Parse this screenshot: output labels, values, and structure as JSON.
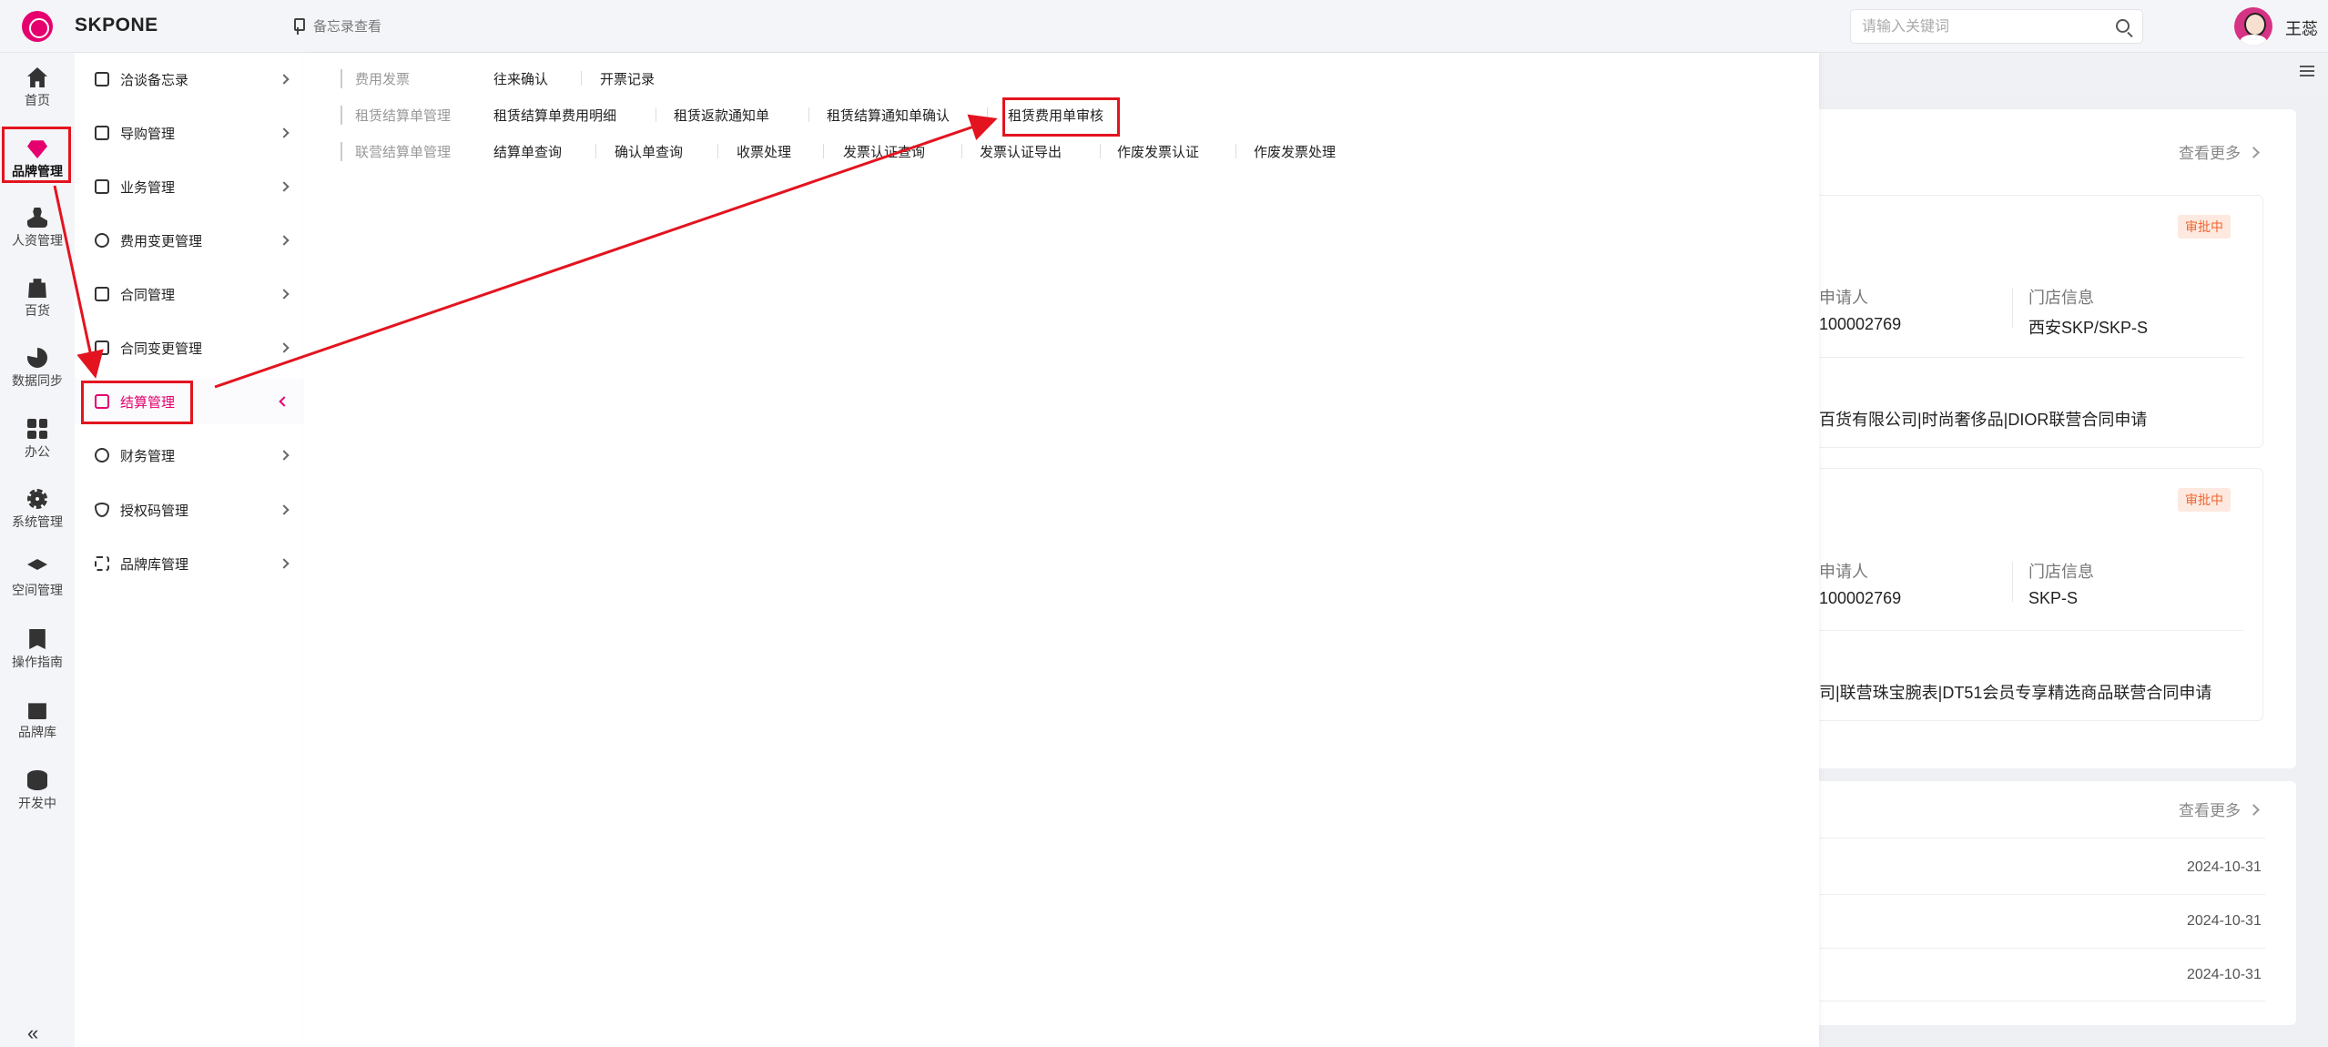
{
  "header": {
    "brand": "SKPONE",
    "memo_label": "备忘录查看",
    "search_placeholder": "请输入关键词",
    "username": "王蕊"
  },
  "rail": [
    {
      "label": "首页",
      "icon": "home-icon"
    },
    {
      "label": "品牌管理",
      "icon": "diamond-icon",
      "active": true
    },
    {
      "label": "人资管理",
      "icon": "person-icon"
    },
    {
      "label": "百货",
      "icon": "bag-icon"
    },
    {
      "label": "数据同步",
      "icon": "pie-icon"
    },
    {
      "label": "办公",
      "icon": "grid-icon"
    },
    {
      "label": "系统管理",
      "icon": "gear-icon"
    },
    {
      "label": "空间管理",
      "icon": "layers-icon"
    },
    {
      "label": "操作指南",
      "icon": "book-icon"
    },
    {
      "label": "品牌库",
      "icon": "store-icon"
    },
    {
      "label": "开发中",
      "icon": "database-icon"
    }
  ],
  "rail_collapse": "«",
  "submenu": [
    {
      "label": "洽谈备忘录"
    },
    {
      "label": "导购管理"
    },
    {
      "label": "业务管理"
    },
    {
      "label": "费用变更管理"
    },
    {
      "label": "合同管理"
    },
    {
      "label": "合同变更管理"
    },
    {
      "label": "结算管理",
      "active": true
    },
    {
      "label": "财务管理"
    },
    {
      "label": "授权码管理"
    },
    {
      "label": "品牌库管理"
    }
  ],
  "flyout": {
    "rows": [
      {
        "group": "费用发票",
        "links": [
          "往来确认",
          "开票记录"
        ]
      },
      {
        "group": "租赁结算单管理",
        "links": [
          "租赁结算单费用明细",
          "租赁返款通知单",
          "租赁结算通知单确认",
          "租赁费用单审核"
        ]
      },
      {
        "group": "联营结算单管理",
        "links": [
          "结算单查询",
          "确认单查询",
          "收票处理",
          "发票认证查询",
          "发票认证导出",
          "作废发票认证",
          "作废发票处理"
        ]
      }
    ]
  },
  "dashboard": {
    "more_label": "查看更多",
    "cards": [
      {
        "status": "审批中",
        "applicant_label": "申请人",
        "applicant_value": "100002769",
        "store_label": "门店信息",
        "store_value": "西安SKP/SKP-S",
        "title": "百货有限公司|时尚奢侈品|DIOR联营合同申请"
      },
      {
        "status": "审批中",
        "applicant_label": "申请人",
        "applicant_value": "100002769",
        "store_label": "门店信息",
        "store_value": "SKP-S",
        "title": "司|联营珠宝腕表|DT51会员专享精选商品联营合同申请"
      }
    ],
    "dates": [
      "2024-10-31",
      "2024-10-31",
      "2024-10-31"
    ]
  },
  "colors": {
    "accent": "#e6006e",
    "annotation": "#e3141f",
    "badge": "#f0662e"
  }
}
